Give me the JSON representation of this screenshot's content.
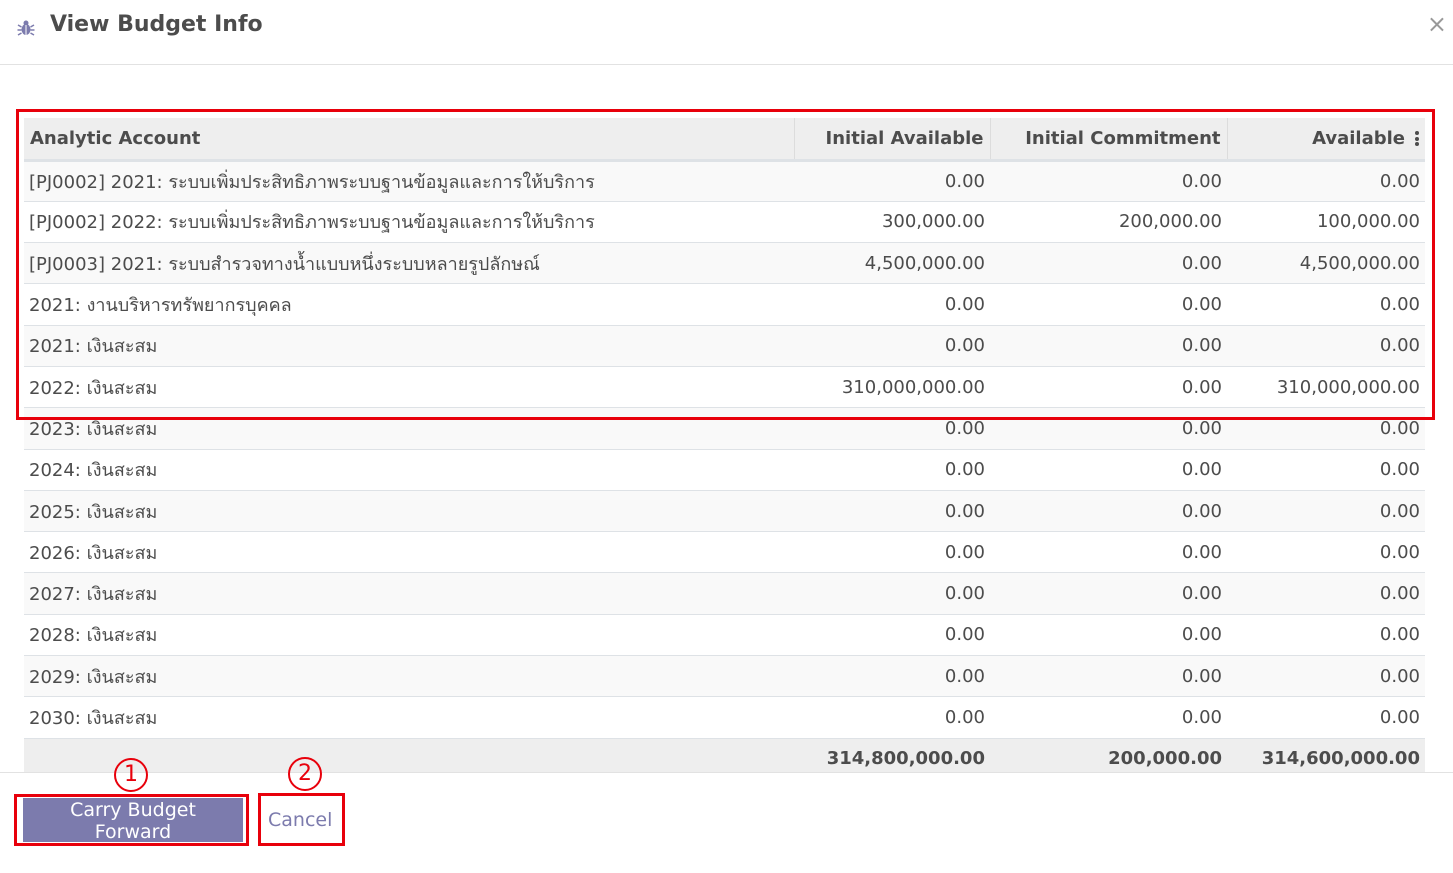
{
  "dialog": {
    "title": "View Budget Info",
    "close_symbol": "×",
    "icon": "bug-icon"
  },
  "table": {
    "columns": [
      "Analytic Account",
      "Initial Available",
      "Initial Commitment",
      "Available"
    ],
    "rows": [
      [
        "[PJ0002] 2021: ระบบเพิ่มประสิทธิภาพระบบฐานข้อมูลและการให้บริการ",
        "0.00",
        "0.00",
        "0.00"
      ],
      [
        "[PJ0002] 2022: ระบบเพิ่มประสิทธิภาพระบบฐานข้อมูลและการให้บริการ",
        "300,000.00",
        "200,000.00",
        "100,000.00"
      ],
      [
        "[PJ0003] 2021: ระบบสำรวจทางน้ำแบบหนึ่งระบบหลายรูปลักษณ์",
        "4,500,000.00",
        "0.00",
        "4,500,000.00"
      ],
      [
        "2021: งานบริหารทรัพยากรบุคคล",
        "0.00",
        "0.00",
        "0.00"
      ],
      [
        "2021: เงินสะสม",
        "0.00",
        "0.00",
        "0.00"
      ],
      [
        "2022: เงินสะสม",
        "310,000,000.00",
        "0.00",
        "310,000,000.00"
      ],
      [
        "2023: เงินสะสม",
        "0.00",
        "0.00",
        "0.00"
      ],
      [
        "2024: เงินสะสม",
        "0.00",
        "0.00",
        "0.00"
      ],
      [
        "2025: เงินสะสม",
        "0.00",
        "0.00",
        "0.00"
      ],
      [
        "2026: เงินสะสม",
        "0.00",
        "0.00",
        "0.00"
      ],
      [
        "2027: เงินสะสม",
        "0.00",
        "0.00",
        "0.00"
      ],
      [
        "2028: เงินสะสม",
        "0.00",
        "0.00",
        "0.00"
      ],
      [
        "2029: เงินสะสม",
        "0.00",
        "0.00",
        "0.00"
      ],
      [
        "2030: เงินสะสม",
        "0.00",
        "0.00",
        "0.00"
      ]
    ],
    "totals": [
      "",
      "314,800,000.00",
      "200,000.00",
      "314,600,000.00"
    ]
  },
  "footer": {
    "carry_forward_label": "Carry Budget Forward",
    "cancel_label": "Cancel"
  },
  "annotations": {
    "marker_1": "1",
    "marker_2": "2"
  },
  "colors": {
    "primary": "#7c7bad",
    "highlight": "#e8000b"
  }
}
